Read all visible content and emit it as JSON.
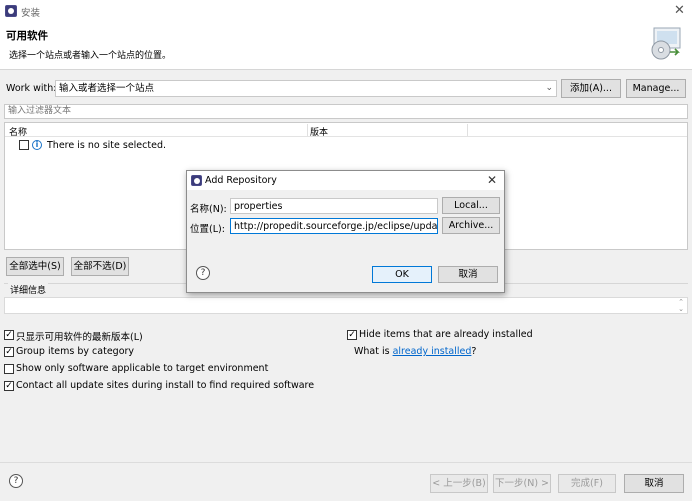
{
  "window": {
    "title": "安装",
    "close_icon": "close-icon"
  },
  "header": {
    "title": "可用软件",
    "subtitle": "选择一个站点或者输入一个站点的位置。"
  },
  "work_with": {
    "label": "Work with:",
    "value": "输入或者选择一个站点",
    "add_button": "添加(A)...",
    "manage_button": "Manage..."
  },
  "filter": {
    "placeholder": "输入过滤器文本"
  },
  "table": {
    "columns": [
      "名称",
      "版本"
    ],
    "empty_message": "There is no site selected."
  },
  "selection": {
    "select_all": "全部选中(S)",
    "deselect_all": "全部不选(D)"
  },
  "details": {
    "label": "详细信息"
  },
  "options": {
    "latest_only": {
      "label": "只显示可用软件的最新版本(L)",
      "checked": true
    },
    "hide_installed": {
      "label": "Hide items that are already installed",
      "checked": true
    },
    "group_by_category": {
      "label": "Group items by category",
      "checked": true
    },
    "what_is_prefix": "What is ",
    "what_is_link": "already installed",
    "what_is_suffix": "?",
    "target_env": {
      "label": "Show only software applicable to target environment",
      "checked": false
    },
    "contact_sites": {
      "label": "Contact all update sites during install to find required software",
      "checked": true
    }
  },
  "footer": {
    "back": "< 上一步(B)",
    "next": "下一步(N) >",
    "finish": "完成(F)",
    "cancel": "取消"
  },
  "dialog": {
    "title": "Add Repository",
    "name_label": "名称(N):",
    "name_value": "properties",
    "local_button": "Local...",
    "location_label": "位置(L):",
    "location_value": "http://propedit.sourceforge.jp/eclipse/updates/",
    "archive_button": "Archive...",
    "ok_button": "OK",
    "cancel_button": "取消"
  },
  "colors": {
    "link": "#0066cc",
    "focus": "#0078d7",
    "info": "#1a73c8"
  }
}
